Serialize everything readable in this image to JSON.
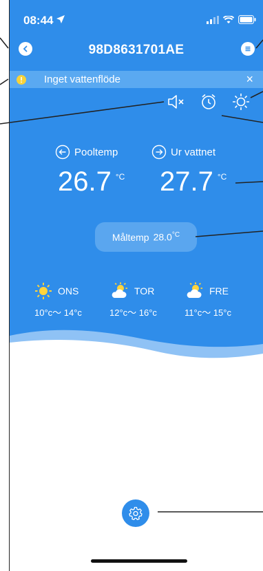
{
  "status": {
    "time": "08:44"
  },
  "nav": {
    "title": "98D8631701AE"
  },
  "alert": {
    "text": "Inget vattenflöde",
    "close": "×"
  },
  "temps": {
    "pool": {
      "label": "Pooltemp",
      "value": "26.7",
      "unit": "°C"
    },
    "out": {
      "label": "Ur vattnet",
      "value": "27.7",
      "unit": "°C"
    }
  },
  "target": {
    "label": "Måltemp",
    "value": "28.0",
    "unit": "°C"
  },
  "weather": [
    {
      "day": "ONS",
      "range": "10°c～ 14°c",
      "icon": "sun-icon"
    },
    {
      "day": "TOR",
      "range": "12°c～ 16°c",
      "icon": "partly-cloudy-icon"
    },
    {
      "day": "FRE",
      "range": "11°c～ 15°c",
      "icon": "partly-cloudy-icon"
    }
  ],
  "colors": {
    "primary": "#2f8dea",
    "alert": "#f7d23a"
  }
}
